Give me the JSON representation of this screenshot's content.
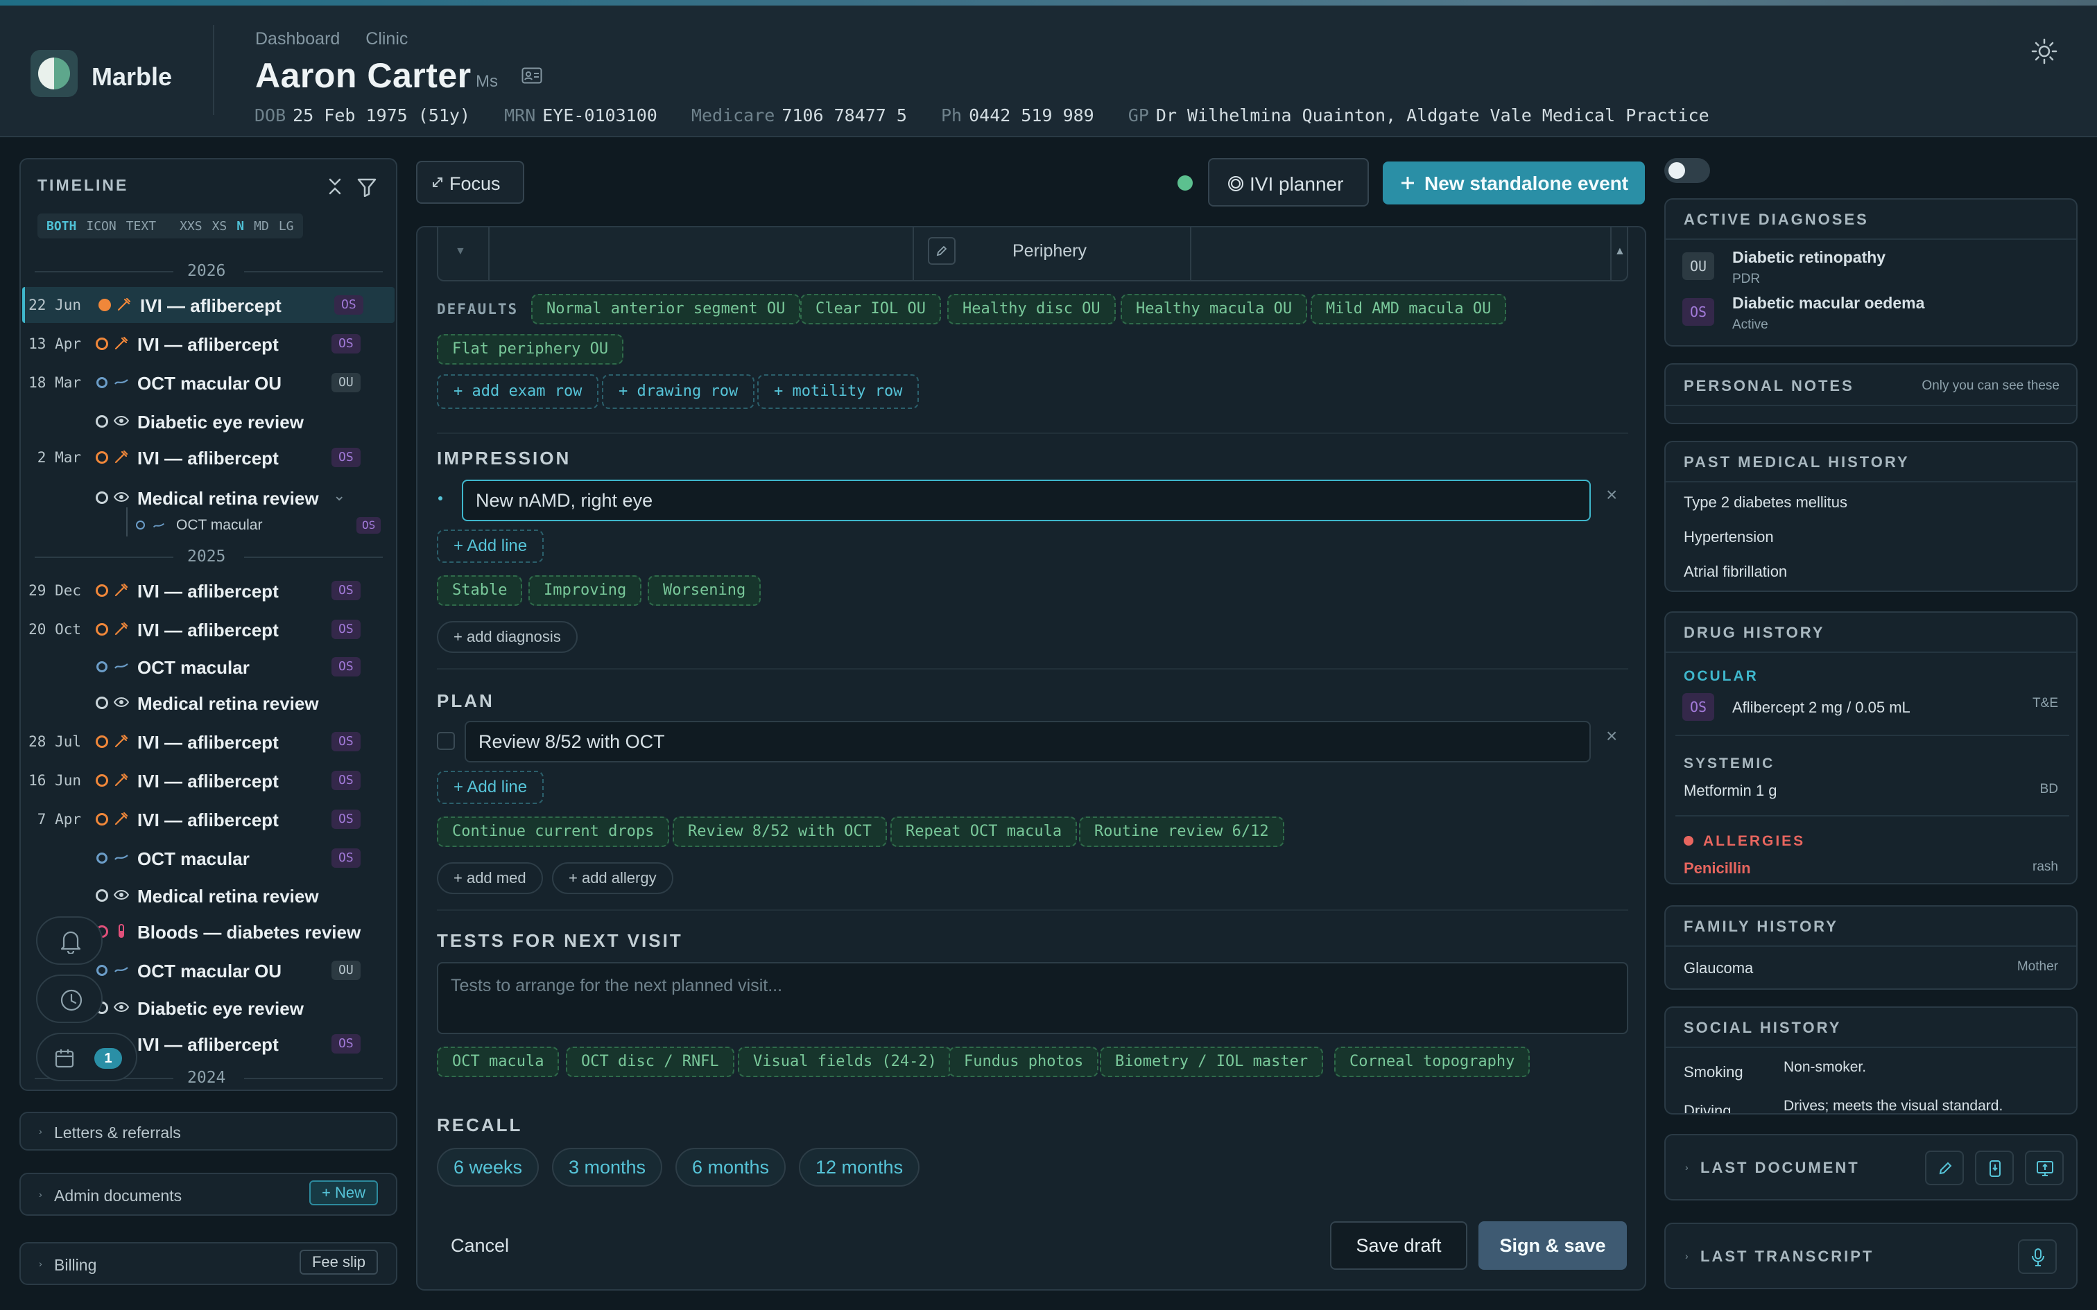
{
  "header": {
    "brand": "Marble",
    "breadcrumbs": [
      "Dashboard",
      "Clinic"
    ],
    "patient_name": "Aaron Carter",
    "patient_title": "Ms",
    "meta": [
      {
        "key": "DOB",
        "value": "25 Feb 1975 (51y)"
      },
      {
        "key": "MRN",
        "value": "EYE-0103100"
      },
      {
        "key": "Medicare",
        "value": "7106 78477 5"
      },
      {
        "key": "Ph",
        "value": "0442 519 989"
      },
      {
        "key": "GP",
        "value": "Dr Wilhelmina Quainton, Aldgate Vale Medical Practice"
      }
    ]
  },
  "timeline": {
    "title": "TIMELINE",
    "modes": [
      "BOTH",
      "ICON",
      "TEXT"
    ],
    "sizes": [
      "XXS",
      "XS",
      "N",
      "MD",
      "LG"
    ],
    "years": [
      "2026",
      "2025",
      "2024"
    ],
    "rows": [
      {
        "date": "22 Jun",
        "label": "IVI — aflibercept",
        "tag": "OS"
      },
      {
        "date": "13 Apr",
        "label": "IVI — aflibercept",
        "tag": "OS"
      },
      {
        "date": "18 Mar",
        "label": "OCT macular OU",
        "tag": "OU"
      },
      {
        "date": "",
        "label": "Diabetic eye review",
        "tag": ""
      },
      {
        "date": "2 Mar",
        "label": "IVI — aflibercept",
        "tag": "OS"
      },
      {
        "date": "",
        "label": "Medical retina review",
        "tag": ""
      },
      {
        "date": "",
        "label": "OCT macular",
        "tag": "OS"
      },
      {
        "date": "29 Dec",
        "label": "IVI — aflibercept",
        "tag": "OS"
      },
      {
        "date": "20 Oct",
        "label": "IVI — aflibercept",
        "tag": "OS"
      },
      {
        "date": "",
        "label": "OCT macular",
        "tag": "OS"
      },
      {
        "date": "",
        "label": "Medical retina review",
        "tag": ""
      },
      {
        "date": "28 Jul",
        "label": "IVI — aflibercept",
        "tag": "OS"
      },
      {
        "date": "16 Jun",
        "label": "IVI — aflibercept",
        "tag": "OS"
      },
      {
        "date": "7 Apr",
        "label": "IVI — aflibercept",
        "tag": "OS"
      },
      {
        "date": "",
        "label": "OCT macular",
        "tag": "OS"
      },
      {
        "date": "",
        "label": "Medical retina review",
        "tag": ""
      },
      {
        "date": "",
        "label": "Bloods — diabetes review",
        "tag": ""
      },
      {
        "date": "",
        "label": "OCT macular OU",
        "tag": "OU"
      },
      {
        "date": "",
        "label": "Diabetic eye review",
        "tag": ""
      },
      {
        "date": "",
        "label": "IVI — aflibercept",
        "tag": "OS"
      }
    ],
    "badge_count": "1"
  },
  "left_sections": {
    "letters": "Letters & referrals",
    "admin": "Admin documents",
    "admin_btn": "+ New",
    "billing": "Billing",
    "billing_btn": "Fee slip"
  },
  "toolbar": {
    "focus": "Focus",
    "ivi_planner": "IVI planner",
    "new_event": "New standalone event"
  },
  "form": {
    "periphery": "Periphery",
    "defaults_label": "DEFAULTS",
    "defaults": [
      "Normal anterior segment OU",
      "Clear IOL OU",
      "Healthy disc OU",
      "Healthy macula OU",
      "Mild AMD macula OU",
      "Flat periphery OU"
    ],
    "add_rows": [
      "+ add exam row",
      "+ drawing row",
      "+ motility row"
    ],
    "impression_title": "IMPRESSION",
    "impression_value": "New nAMD, right eye",
    "add_line": "+ Add line",
    "impression_chips": [
      "Stable",
      "Improving",
      "Worsening"
    ],
    "add_diagnosis": "+ add diagnosis",
    "plan_title": "PLAN",
    "plan_value": "Review 8/52 with OCT",
    "plan_chips": [
      "Continue current drops",
      "Review 8/52 with OCT",
      "Repeat OCT macula",
      "Routine review 6/12"
    ],
    "add_med": "+ add med",
    "add_allergy": "+ add allergy",
    "tests_title": "TESTS FOR NEXT VISIT",
    "tests_placeholder": "Tests to arrange for the next planned visit...",
    "test_chips": [
      "OCT macula",
      "OCT disc / RNFL",
      "Visual fields (24-2)",
      "Fundus photos",
      "Biometry / IOL master",
      "Corneal topography"
    ],
    "recall_title": "RECALL",
    "recall": [
      "6 weeks",
      "3 months",
      "6 months",
      "12 months"
    ],
    "cancel": "Cancel",
    "save_draft": "Save draft",
    "sign_save": "Sign & save"
  },
  "right": {
    "active_dx_title": "ACTIVE DIAGNOSES",
    "diagnoses": [
      {
        "eye": "OU",
        "name": "Diabetic retinopathy",
        "sub": "PDR"
      },
      {
        "eye": "OS",
        "name": "Diabetic macular oedema",
        "sub": "Active"
      }
    ],
    "notes_title": "PERSONAL NOTES",
    "notes_hint": "Only you can see these",
    "pmh_title": "PAST MEDICAL HISTORY",
    "pmh": [
      "Type 2 diabetes mellitus",
      "Hypertension",
      "Atrial fibrillation"
    ],
    "drug_title": "DRUG HISTORY",
    "ocular_label": "OCULAR",
    "ocular_drug": {
      "eye": "OS",
      "name": "Aflibercept 2 mg / 0.05 mL",
      "freq": "T&E"
    },
    "systemic_label": "SYSTEMIC",
    "systemic_drug": {
      "name": "Metformin 1 g",
      "freq": "BD"
    },
    "allergies_label": "ALLERGIES",
    "allergy": {
      "name": "Penicillin",
      "reaction": "rash"
    },
    "family_title": "FAMILY HISTORY",
    "family": {
      "name": "Glaucoma",
      "rel": "Mother"
    },
    "social_title": "SOCIAL HISTORY",
    "social": [
      {
        "k": "Smoking",
        "v": "Non-smoker."
      },
      {
        "k": "Driving",
        "v": "Drives; meets the visual standard."
      }
    ],
    "last_document": "LAST DOCUMENT",
    "last_transcript": "LAST TRANSCRIPT"
  },
  "colors": {
    "accent": "#2a8fa6",
    "orange": "#f0873a",
    "os_purple": "#a27ad9",
    "chip_green": "#79c89a",
    "allergy_red": "#e8665f"
  }
}
